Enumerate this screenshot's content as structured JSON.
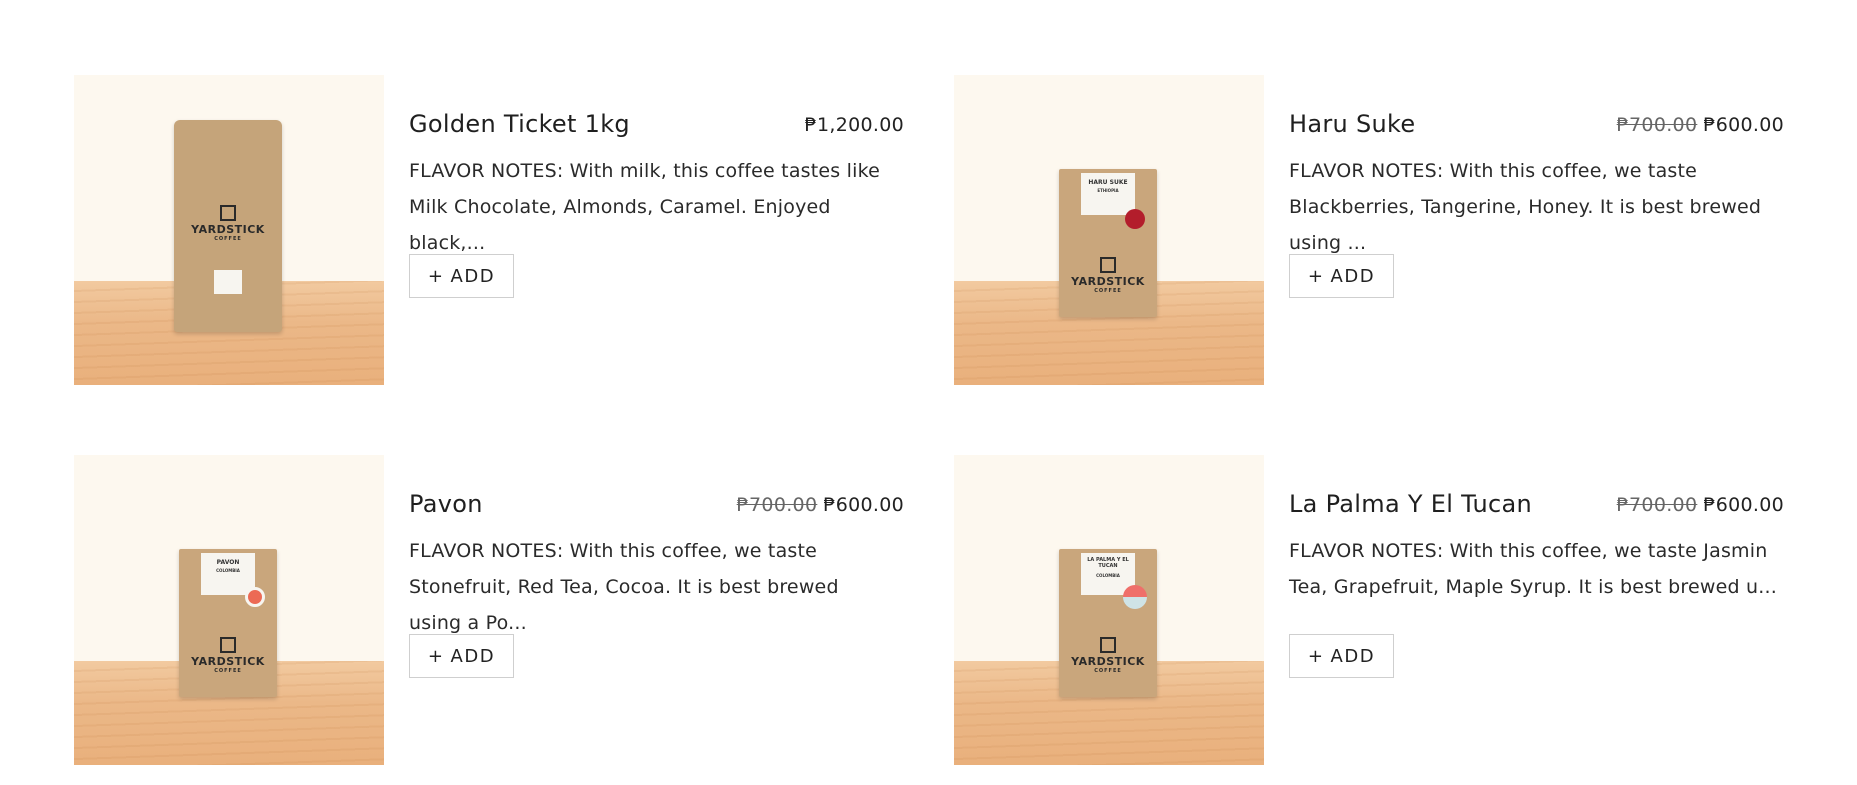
{
  "products": [
    {
      "title": "Golden Ticket 1kg",
      "price_old": "",
      "price": "₱1,200.00",
      "description": "FLAVOR NOTES: With milk, this coffee tastes like Milk Chocolate, Almonds, Caramel. Enjoyed black,...",
      "add_plus": "+",
      "add_label": "ADD",
      "bag": {
        "brand": "YARDSTICK",
        "sub": "COFFEE",
        "label_line1": "",
        "label_line2": ""
      }
    },
    {
      "title": "Haru Suke",
      "price_old": "₱700.00",
      "price": "₱600.00",
      "description": "FLAVOR NOTES: With this coffee, we taste Blackberries, Tangerine, Honey. It is best brewed using ...",
      "add_plus": "+",
      "add_label": "ADD",
      "bag": {
        "brand": "YARDSTICK",
        "sub": "COFFEE",
        "label_line1": "HARU SUKE",
        "label_line2": "ETHIOPIA",
        "dot_color": "#b31d2b"
      }
    },
    {
      "title": "Pavon",
      "price_old": "₱700.00",
      "price": "₱600.00",
      "description": "FLAVOR NOTES: With this coffee, we taste Stonefruit, Red Tea, Cocoa. It is best brewed using a Po...",
      "add_plus": "+",
      "add_label": "ADD",
      "bag": {
        "brand": "YARDSTICK",
        "sub": "COFFEE",
        "label_line1": "PAVON",
        "label_line2": "COLOMBIA",
        "dot_color": "#ec6a55"
      }
    },
    {
      "title": "La Palma Y El Tucan",
      "price_old": "₱700.00",
      "price": "₱600.00",
      "description": "FLAVOR NOTES: With this coffee, we taste Jasmin Tea, Grapefruit, Maple Syrup. It is best brewed u...",
      "add_plus": "+",
      "add_label": "ADD",
      "bag": {
        "brand": "YARDSTICK",
        "sub": "COFFEE",
        "label_line1": "LA PALMA Y EL TUCAN",
        "label_line2": "COLOMBIA",
        "dot_color": "#ef6f6a"
      }
    }
  ]
}
